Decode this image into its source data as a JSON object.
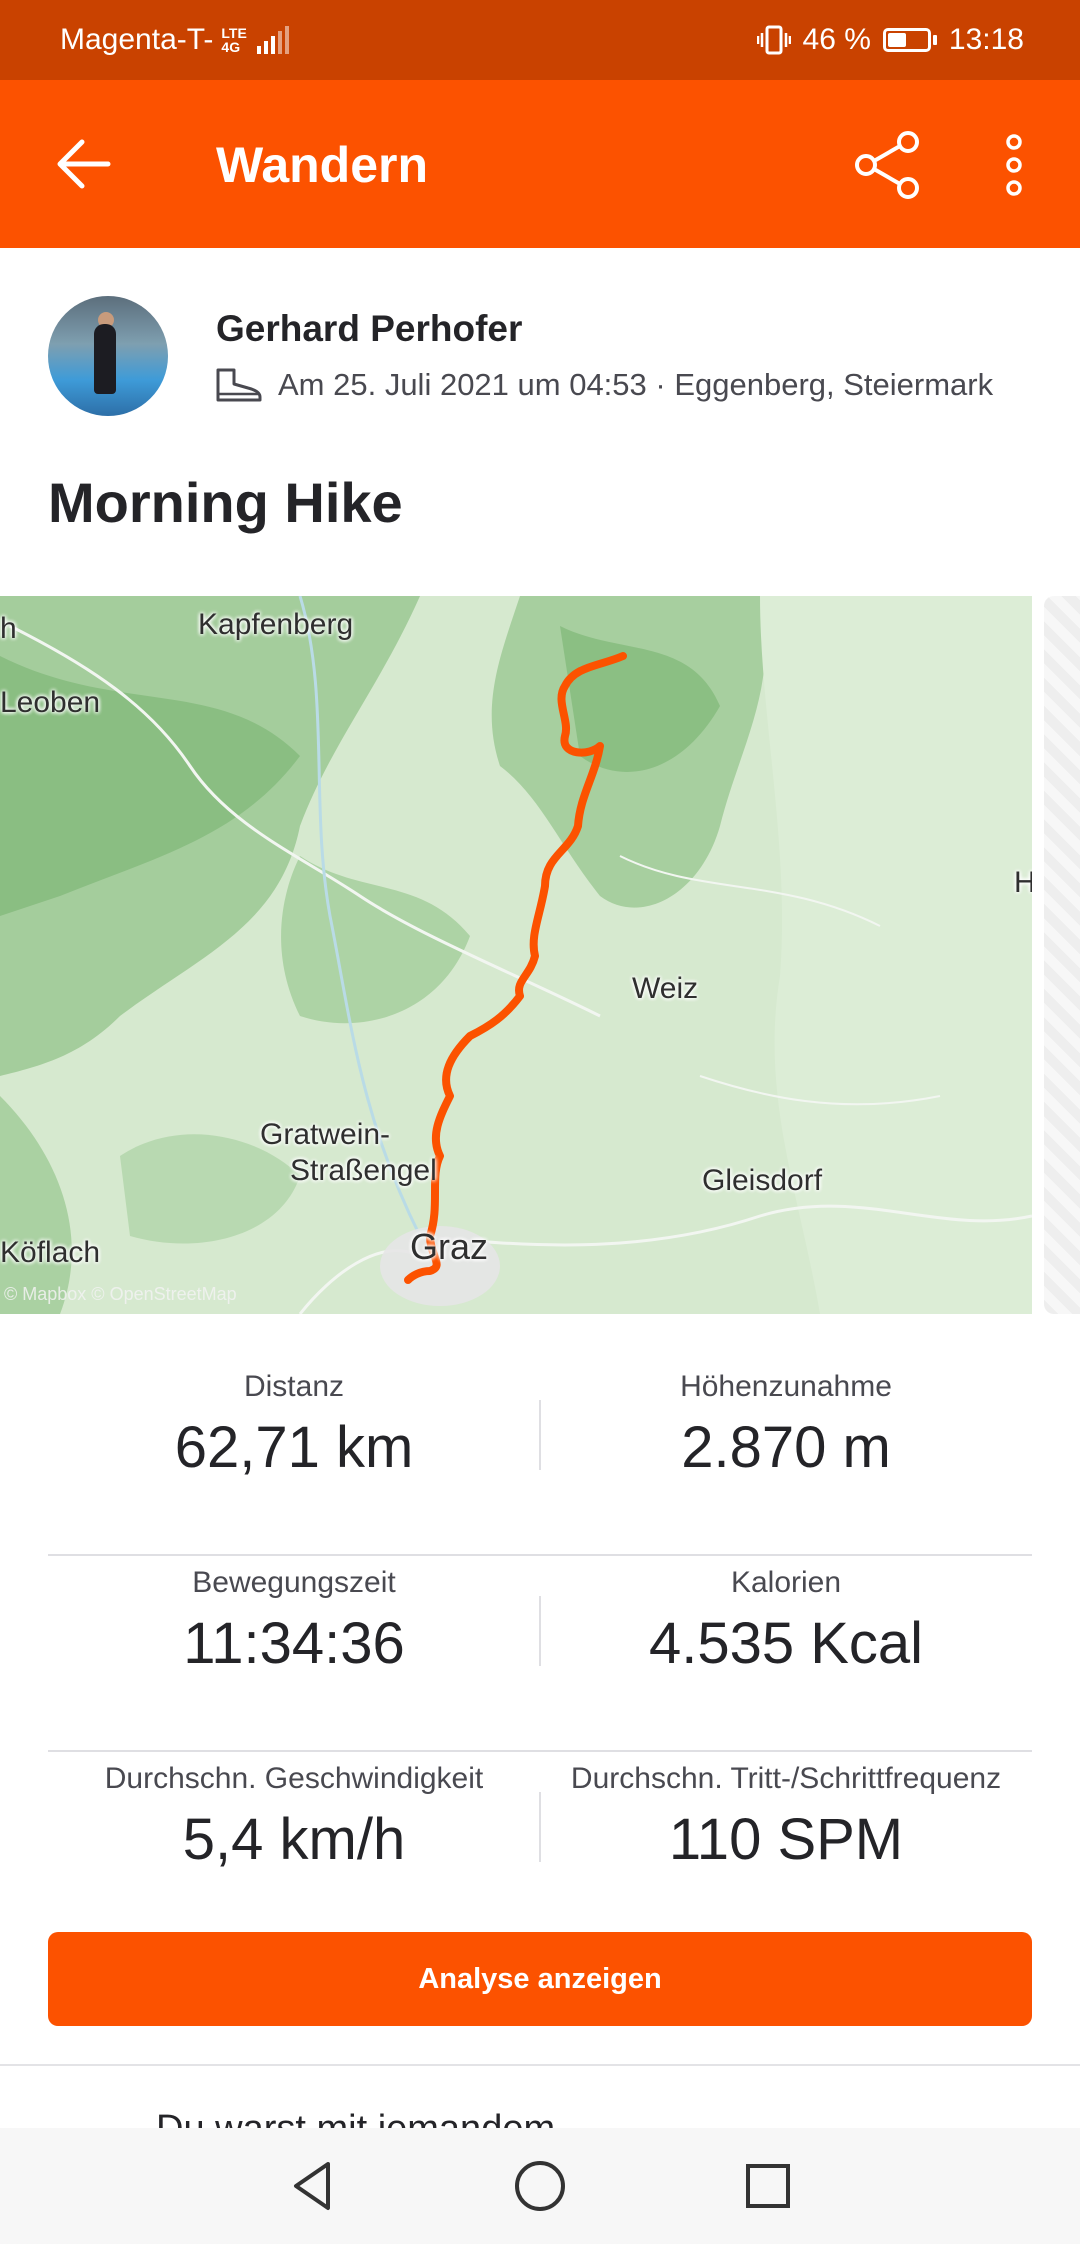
{
  "status_bar": {
    "carrier": "Magenta-T-",
    "network_top": "LTE",
    "network_bottom": "4G",
    "battery": "46 %",
    "battery_level": 0.46,
    "time": "13:18"
  },
  "app_bar": {
    "title": "Wandern",
    "icons": [
      "arrow-back-icon",
      "share-icon",
      "more-vert-icon"
    ]
  },
  "athlete": {
    "name": "Gerhard Perhofer",
    "meta": "Am 25. Juli 2021 um 04:53 · Eggenberg, Steiermark",
    "icon": "hiking-boot-icon"
  },
  "activity": {
    "title": "Morning Hike"
  },
  "map": {
    "labels": {
      "kapfenberg": "Kapfenberg",
      "leoben": "Leoben",
      "weiz": "Weiz",
      "gratwein_1": "Gratwein-",
      "gratwein_2": "Straßengel",
      "gleisdorf": "Gleisdorf",
      "graz": "Graz",
      "koflach": "Köflach",
      "h_right": "H",
      "h_left": "h"
    },
    "attribution": "© Mapbox © OpenStreetMap",
    "route_color": "#fc5200"
  },
  "stats": [
    {
      "left": {
        "label": "Distanz",
        "value": "62,71 km"
      },
      "right": {
        "label": "Höhenzunahme",
        "value": "2.870 m"
      }
    },
    {
      "left": {
        "label": "Bewegungszeit",
        "value": "11:34:36"
      },
      "right": {
        "label": "Kalorien",
        "value": "4.535 Kcal"
      }
    },
    {
      "left": {
        "label": "Durchschn. Geschwindigkeit",
        "value": "5,4 km/h"
      },
      "right": {
        "label": "Durchschn. Tritt-/Schrittfrequenz",
        "value": "110 SPM"
      }
    }
  ],
  "analyse_button": "Analyse anzeigen",
  "partial_section": "Du warst mit jemandem",
  "nav_bar": [
    "back-triangle-icon",
    "home-circle-icon",
    "recents-square-icon"
  ],
  "colors": {
    "accent": "#fc5200",
    "status_bar": "#c94200"
  }
}
